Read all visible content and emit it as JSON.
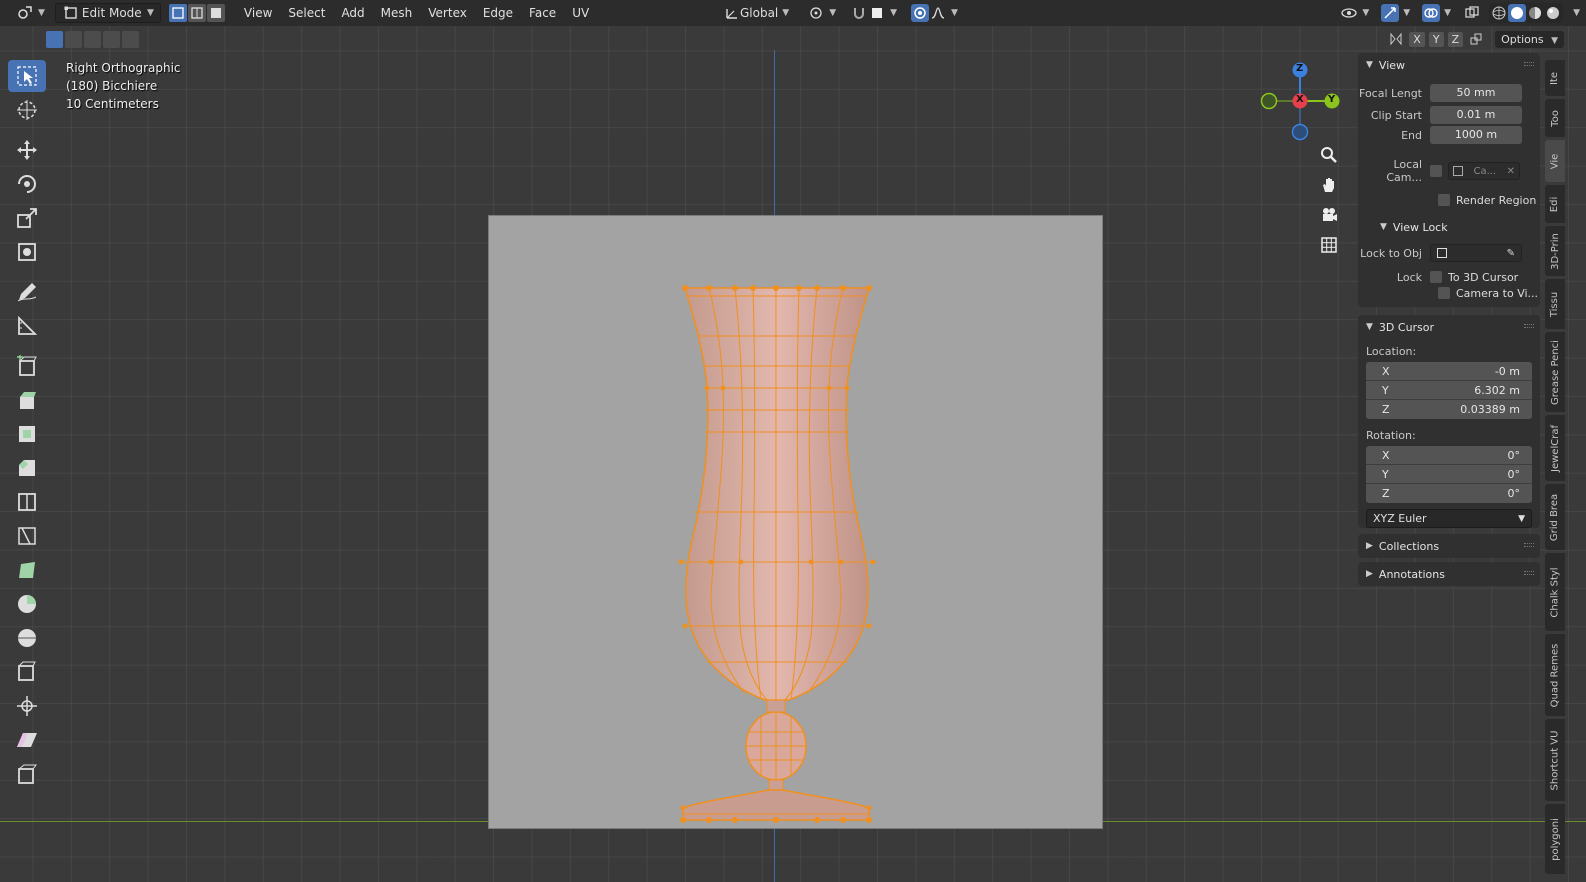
{
  "header": {
    "mode": "Edit Mode",
    "menus": [
      "View",
      "Select",
      "Add",
      "Mesh",
      "Vertex",
      "Edge",
      "Face",
      "UV"
    ],
    "transform_orientation": "Global"
  },
  "subheader": {
    "axis_x": "X",
    "axis_y": "Y",
    "axis_z": "Z",
    "options": "Options"
  },
  "overlay": {
    "view_name": "Right Orthographic",
    "object_name": "(180) Bicchiere",
    "scale": "10 Centimeters"
  },
  "gizmo": {
    "z": "Z",
    "x": "X",
    "y": "Y"
  },
  "npanel": {
    "view": {
      "title": "View",
      "focal_label": "Focal Lengt",
      "focal_value": "50 mm",
      "clip_start_label": "Clip Start",
      "clip_start_value": "0.01 m",
      "end_label": "End",
      "end_value": "1000 m",
      "local_cam_label": "Local Cam...",
      "local_cam_value": "Ca...",
      "render_region": "Render Region"
    },
    "view_lock": {
      "title": "View Lock",
      "lock_obj_label": "Lock to Obj",
      "lock_label": "Lock",
      "to_cursor": "To 3D Cursor",
      "camera_to_view": "Camera to Vi..."
    },
    "cursor": {
      "title": "3D Cursor",
      "location_label": "Location:",
      "loc_x_label": "X",
      "loc_x": "-0 m",
      "loc_y_label": "Y",
      "loc_y": "6.302 m",
      "loc_z_label": "Z",
      "loc_z": "0.03389 m",
      "rotation_label": "Rotation:",
      "rot_x_label": "X",
      "rot_x": "0°",
      "rot_y_label": "Y",
      "rot_y": "0°",
      "rot_z_label": "Z",
      "rot_z": "0°",
      "rotation_mode": "XYZ Euler"
    },
    "collections": "Collections",
    "annotations": "Annotations"
  },
  "side_tabs": [
    "Ite",
    "Too",
    "Vie",
    "Edi",
    "3D-Prin",
    "Tissu",
    "Grease Penci",
    "JewelCraf",
    "Grid Brea",
    "Chalk Styl",
    "Quad Remes",
    "Shortcut VU",
    "polygoni"
  ],
  "colors": {
    "accent": "#4772b3",
    "mesh_orange": "#f0901e",
    "axis_x": "#e6404a",
    "axis_y": "#8bc51c",
    "axis_z": "#3b82e0"
  }
}
